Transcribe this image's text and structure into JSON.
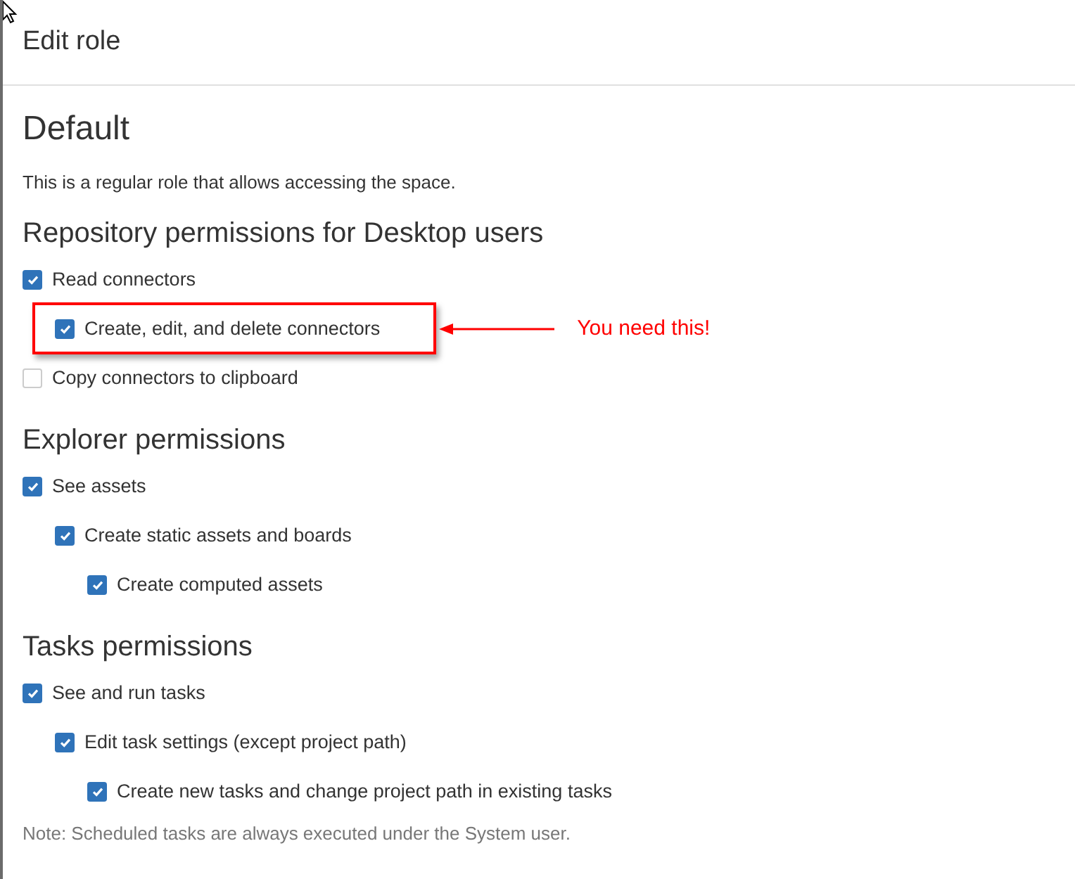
{
  "dialog": {
    "title": "Edit role"
  },
  "role": {
    "name": "Default",
    "description": "This is a regular role that allows accessing the space."
  },
  "sections": [
    {
      "heading": "Repository permissions for Desktop users",
      "permissions": [
        {
          "label": "Read connectors",
          "checked": true,
          "highlighted": false,
          "children": [
            {
              "label": "Create, edit, and delete connectors",
              "checked": true,
              "highlighted": true,
              "callout": "You need this!"
            }
          ]
        },
        {
          "label": "Copy connectors to clipboard",
          "checked": false,
          "highlighted": false
        }
      ]
    },
    {
      "heading": "Explorer permissions",
      "permissions": [
        {
          "label": "See assets",
          "checked": true,
          "highlighted": false,
          "children": [
            {
              "label": "Create static assets and boards",
              "checked": true,
              "highlighted": false,
              "children": [
                {
                  "label": "Create computed assets",
                  "checked": true,
                  "highlighted": false
                }
              ]
            }
          ]
        }
      ]
    },
    {
      "heading": "Tasks permissions",
      "permissions": [
        {
          "label": "See and run tasks",
          "checked": true,
          "highlighted": false,
          "children": [
            {
              "label": "Edit task settings (except project path)",
              "checked": true,
              "highlighted": false,
              "children": [
                {
                  "label": "Create new tasks and change project path in existing tasks",
                  "checked": true,
                  "highlighted": false
                }
              ]
            }
          ]
        }
      ]
    }
  ],
  "note": "Note: Scheduled tasks are always executed under the System user."
}
